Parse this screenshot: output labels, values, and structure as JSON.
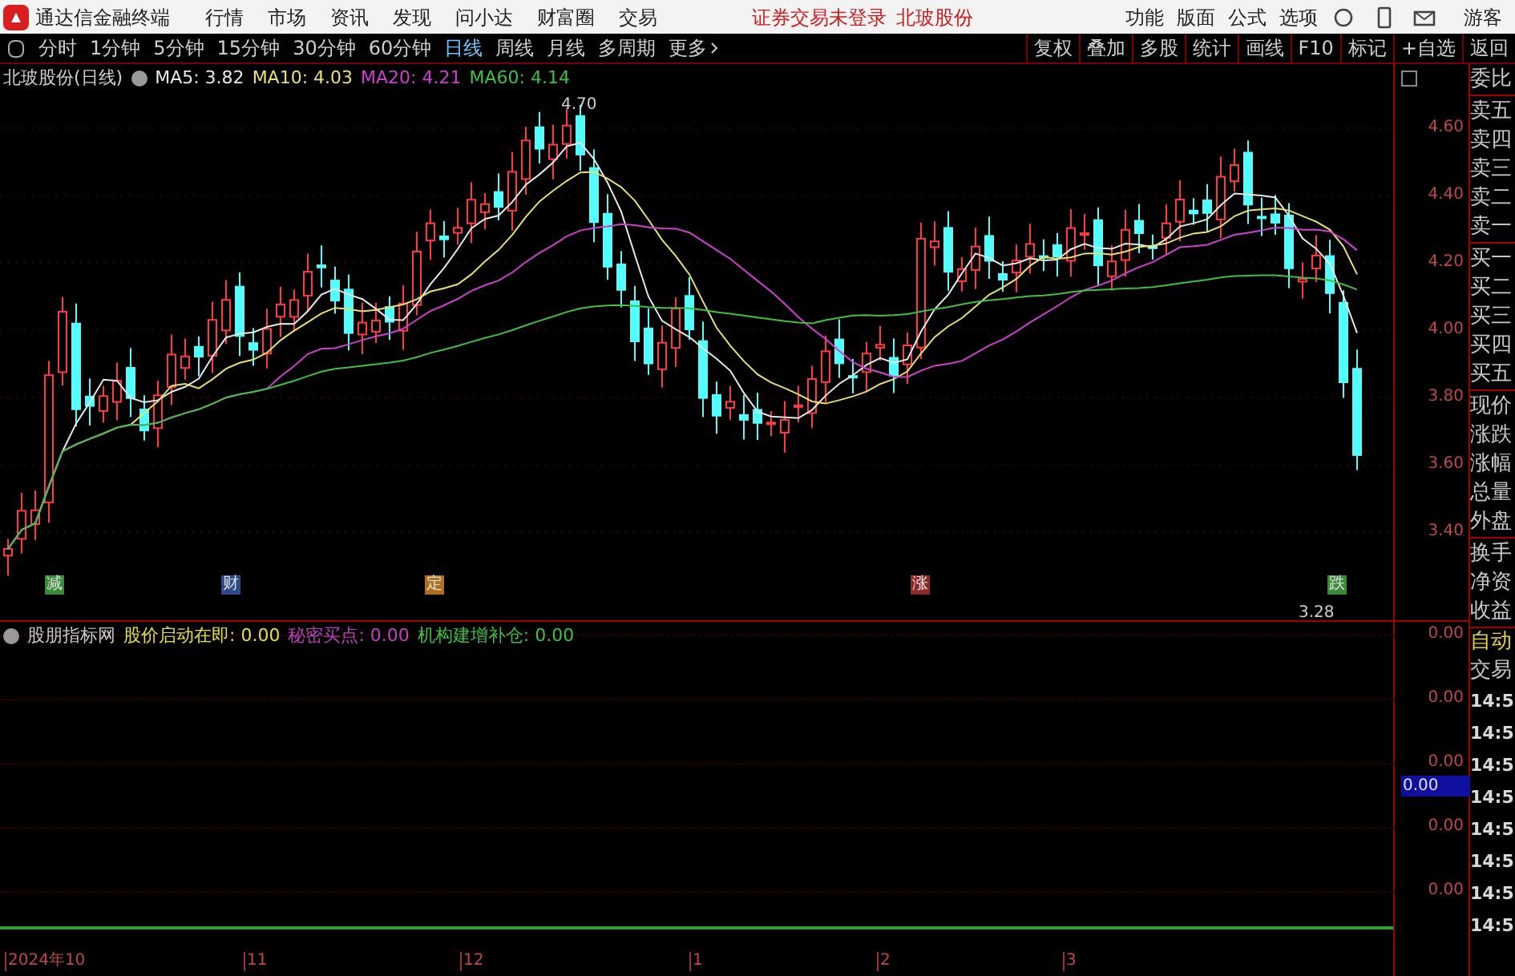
{
  "app": {
    "title": "通达信金融终端",
    "menu": [
      "行情",
      "市场",
      "资讯",
      "发现",
      "问小达",
      "财富圈",
      "交易"
    ],
    "notice": "证券交易未登录",
    "stock": "北玻股份",
    "right_menu": [
      "功能",
      "版面",
      "公式",
      "选项"
    ],
    "user": "游客"
  },
  "periods": [
    {
      "label": "分时",
      "selected": false
    },
    {
      "label": "1分钟",
      "selected": false
    },
    {
      "label": "5分钟",
      "selected": false
    },
    {
      "label": "15分钟",
      "selected": false
    },
    {
      "label": "30分钟",
      "selected": false
    },
    {
      "label": "60分钟",
      "selected": false
    },
    {
      "label": "日线",
      "selected": true
    },
    {
      "label": "周线",
      "selected": false
    },
    {
      "label": "月线",
      "selected": false
    },
    {
      "label": "多周期",
      "selected": false
    },
    {
      "label": "更多",
      "selected": false
    }
  ],
  "tools": [
    "复权",
    "叠加",
    "多股",
    "统计",
    "画线",
    "F10",
    "标记",
    "+自选",
    "返回"
  ],
  "chart": {
    "title": "北玻股份(日线)",
    "ma": [
      {
        "label": "MA5: 3.82",
        "color": "#e8e8e8"
      },
      {
        "label": "MA10: 4.03",
        "color": "#e8e070"
      },
      {
        "label": "MA20: 4.21",
        "color": "#d040d0"
      },
      {
        "label": "MA60: 4.14",
        "color": "#40c040"
      }
    ],
    "high_label": "4.70",
    "low_label": "3.28",
    "price_ticks": [
      "4.60",
      "4.40",
      "4.20",
      "4.00",
      "3.80",
      "3.60",
      "3.40"
    ],
    "signals": [
      {
        "label": "减",
        "color": "#3a8a3a"
      },
      {
        "label": "财",
        "color": "#2a4a8a"
      },
      {
        "label": "定",
        "color": "#b07020"
      },
      {
        "label": "涨",
        "color": "#8a2a2a"
      },
      {
        "label": "跌",
        "color": "#3a8a3a"
      }
    ]
  },
  "indicator": {
    "title": "股朋指标网",
    "values": [
      {
        "label": "股价启动在即: 0.00",
        "color": "#e0e040"
      },
      {
        "label": "秘密买点: 0.00",
        "color": "#c040c0"
      },
      {
        "label": "机构建增补仓: 0.00",
        "color": "#40c040"
      }
    ],
    "ticks": [
      "0.00",
      "0.00",
      "0.00",
      "0.00",
      "0.00"
    ],
    "cursor_value": "0.00"
  },
  "time_axis": [
    "2024年10",
    "11",
    "12",
    "1",
    "2",
    "3"
  ],
  "side_panel": {
    "quote_groups": [
      [
        "委比"
      ],
      [
        "卖五",
        "卖四",
        "卖三",
        "卖二",
        "卖一"
      ],
      [
        "买一",
        "买二",
        "买三",
        "买四",
        "买五"
      ],
      [
        "现价",
        "涨跌",
        "涨幅",
        "总量",
        "外盘"
      ],
      [
        "换手",
        "净资",
        "收益"
      ]
    ],
    "auto": "自动",
    "trade": "交易",
    "times": [
      "14:5",
      "14:5",
      "14:5",
      "14:5",
      "14:5",
      "14:5",
      "14:5",
      "14:5"
    ]
  }
}
